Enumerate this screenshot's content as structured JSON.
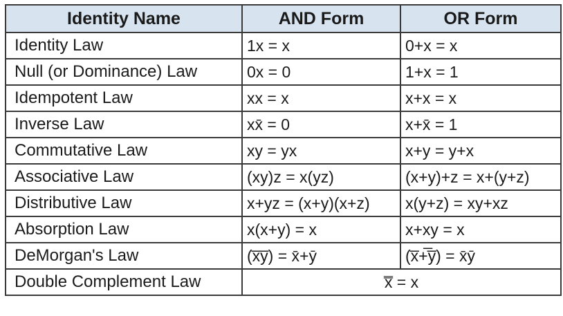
{
  "headers": {
    "identity_name": "Identity Name",
    "and_form": "AND Form",
    "or_form": "OR Form"
  },
  "header_background": "#d7e4f0",
  "border_color": "#3a3a3a",
  "rows": [
    {
      "name": "Identity Law",
      "and_form": "1x = x",
      "or_form": "0+x = x"
    },
    {
      "name": "Null (or Dominance) Law",
      "and_form": "0x = 0",
      "or_form": "1+x = 1"
    },
    {
      "name": "Idempotent Law",
      "and_form": "xx = x",
      "or_form": "x+x = x"
    },
    {
      "name": "Inverse Law",
      "and_form": "xx̄ = 0",
      "or_form": "x+x̄ = 1"
    },
    {
      "name": "Commutative Law",
      "and_form": "xy = yx",
      "or_form": "x+y = y+x"
    },
    {
      "name": "Associative Law",
      "and_form": "(xy)z = x(yz)",
      "or_form": "(x+y)+z = x+(y+z)"
    },
    {
      "name": "Distributive Law",
      "and_form": "x+yz = (x+y)(x+z)",
      "or_form": "x(y+z) = xy+xz"
    },
    {
      "name": "Absorption Law",
      "and_form": "x(x+y) = x",
      "or_form": "x+xy = x"
    },
    {
      "name": "DeMorgan's Law",
      "and_form": "(x̅y̅) = x̄+ȳ",
      "or_form": "(x̅+̅y̅) = x̄ȳ"
    }
  ],
  "double_complement": {
    "name": "Double Complement Law",
    "formula": "x̿ = x"
  }
}
